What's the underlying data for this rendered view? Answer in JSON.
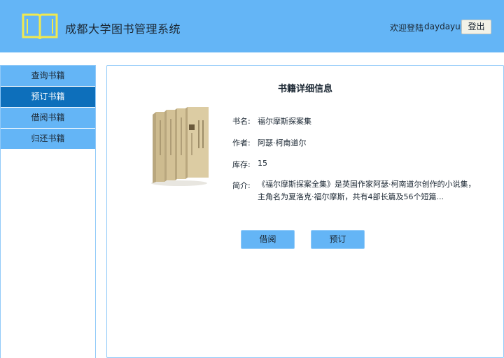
{
  "header": {
    "title": "成都大学图书管理系统",
    "welcome_text": "欢迎登陆",
    "username": "daydayup",
    "logout_label": "登出",
    "logo_icon": "open-book-icon"
  },
  "sidebar": {
    "items": [
      {
        "label": "查询书籍",
        "active": false
      },
      {
        "label": "预订书籍",
        "active": true
      },
      {
        "label": "借阅书籍",
        "active": false
      },
      {
        "label": "归还书籍",
        "active": false
      }
    ]
  },
  "detail": {
    "title": "书籍详细信息",
    "fields": {
      "name_label": "书名:",
      "name_value": "福尔摩斯探案集",
      "author_label": "作者:",
      "author_value": "阿瑟·柯南道尔",
      "stock_label": "库存:",
      "stock_value": "15",
      "summary_label": "简介:",
      "summary_value": "《福尔摩斯探案全集》是英国作家阿瑟·柯南道尔创作的小说集，主角名为夏洛克·福尔摩斯，共有4部长篇及56个短篇..."
    },
    "buttons": {
      "borrow_label": "借阅",
      "reserve_label": "预订"
    }
  },
  "colors": {
    "header_bg": "#64b5f6",
    "active_item": "#0d6fbb",
    "logo_yellow": "#f2e94e"
  }
}
